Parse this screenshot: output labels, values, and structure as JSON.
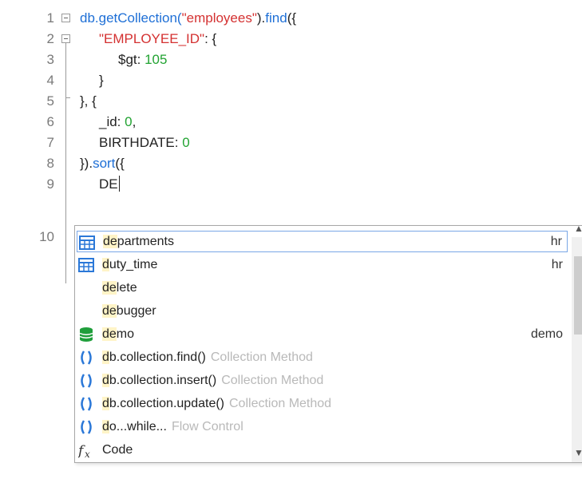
{
  "editor": {
    "line_numbers": [
      "1",
      "2",
      "3",
      "4",
      "5",
      "6",
      "7",
      "8",
      "9",
      "10"
    ],
    "lines": {
      "l1": {
        "a": "db.",
        "b": "getCollection(",
        "c": "\"employees\"",
        "d": ").",
        "e": "find",
        "f": "({"
      },
      "l2": {
        "a": "\"EMPLOYEE_ID\"",
        "b": ": {"
      },
      "l3": {
        "a": "$gt: ",
        "b": "105"
      },
      "l4": {
        "a": "}"
      },
      "l5": {
        "a": "}, {"
      },
      "l6": {
        "a": "_id: ",
        "b": "0",
        "c": ","
      },
      "l7": {
        "a": "BIRTHDATE: ",
        "b": "0"
      },
      "l8": {
        "a": "}).",
        "b": "sort",
        "c": "({"
      },
      "l9": {
        "a": "DE"
      }
    }
  },
  "autocomplete": {
    "items": [
      {
        "pre": "de",
        "rest": "partments",
        "hint": "",
        "right": "hr",
        "icon": "table-icon"
      },
      {
        "pre": "d",
        "rest": "uty_time",
        "hint": "",
        "right": "hr",
        "icon": "table-icon"
      },
      {
        "pre": "de",
        "rest": "lete",
        "hint": "",
        "right": "",
        "icon": ""
      },
      {
        "pre": "de",
        "rest": "bugger",
        "hint": "",
        "right": "",
        "icon": ""
      },
      {
        "pre": "de",
        "rest": "mo",
        "hint": "",
        "right": "demo",
        "icon": "database-icon"
      },
      {
        "pre": "d",
        "rest": "b.collection.find()",
        "hint": "Collection Method",
        "right": "",
        "icon": "method-icon"
      },
      {
        "pre": "d",
        "rest": "b.collection.insert()",
        "hint": "Collection Method",
        "right": "",
        "icon": "method-icon"
      },
      {
        "pre": "d",
        "rest": "b.collection.update()",
        "hint": "Collection Method",
        "right": "",
        "icon": "method-icon"
      },
      {
        "pre": "d",
        "rest": "o...while...",
        "hint": "Flow Control",
        "right": "",
        "icon": "method-icon"
      },
      {
        "pre": "",
        "rest": "Code",
        "hint": "",
        "right": "",
        "icon": "function-icon"
      }
    ]
  },
  "colors": {
    "keyword_blue": "#1e6fd6",
    "string_red": "#d43131",
    "number_green": "#22a332",
    "match_highlight": "#fff4c7"
  }
}
